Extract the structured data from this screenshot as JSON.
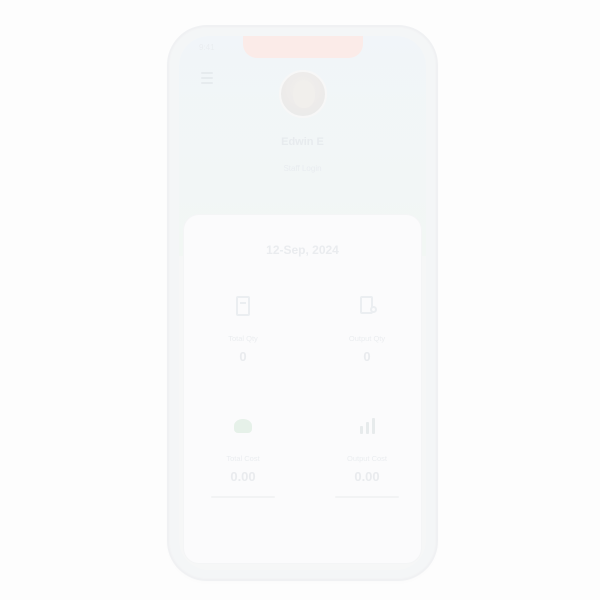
{
  "status": {
    "time": "9:41"
  },
  "profile": {
    "name": "Edwin E",
    "role": "Staff Login"
  },
  "dashboard": {
    "date": "12-Sep, 2024",
    "tiles": [
      {
        "label": "Total Qty",
        "value": "0",
        "icon": "box-icon"
      },
      {
        "label": "Output Qty",
        "value": "0",
        "icon": "document-edit-icon"
      },
      {
        "label": "Total Cost",
        "value": "0.00",
        "icon": "money-icon"
      },
      {
        "label": "Output Cost",
        "value": "0.00",
        "icon": "export-icon"
      }
    ]
  },
  "colors": {
    "header_tint": "#f0f4f9",
    "notch": "#fbe9e5",
    "card": "#fbfbfc",
    "money_icon": "#e2efe6"
  }
}
